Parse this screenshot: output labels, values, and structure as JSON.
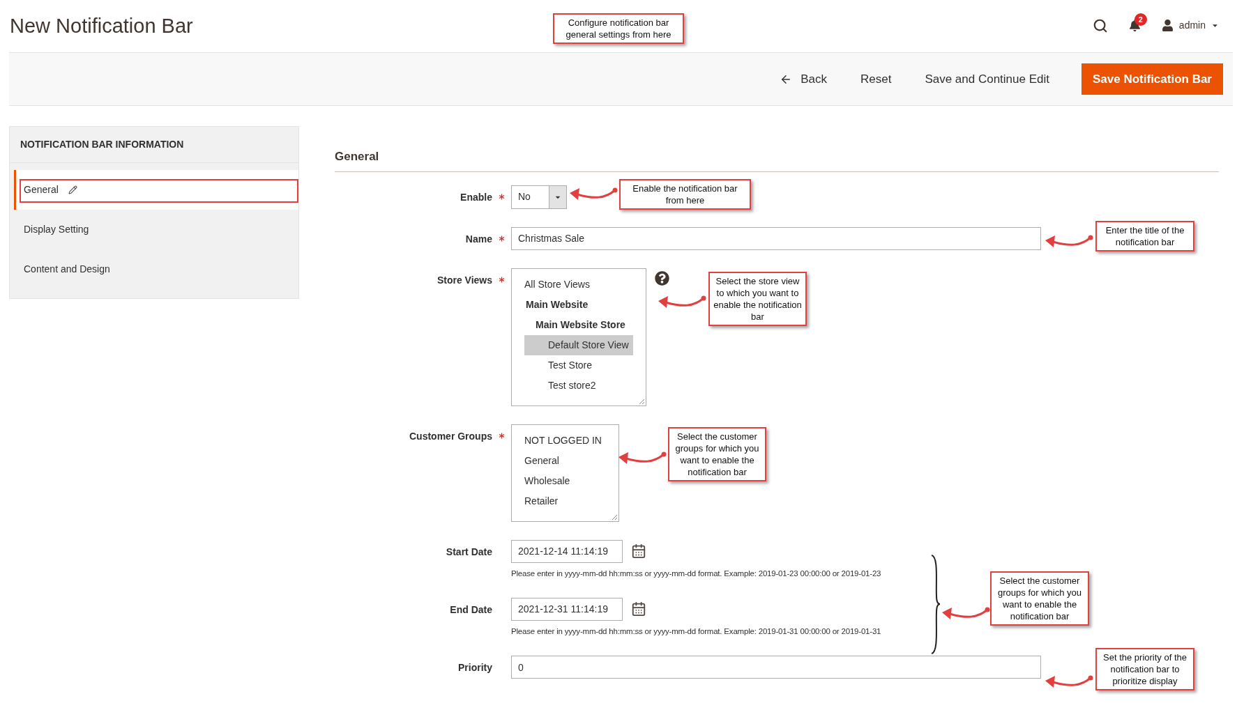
{
  "header": {
    "title": "New Notification Bar",
    "notification_count": "2",
    "user": "admin"
  },
  "actions": [
    {
      "label": "Back",
      "kind": "back"
    },
    {
      "label": "Reset",
      "kind": "plain"
    },
    {
      "label": "Save and Continue Edit",
      "kind": "plain"
    },
    {
      "label": "Save Notification Bar",
      "kind": "primary"
    }
  ],
  "sidebar": {
    "title": "NOTIFICATION BAR INFORMATION",
    "items": [
      {
        "label": "General",
        "selected": true
      },
      {
        "label": "Display Setting",
        "selected": false
      },
      {
        "label": "Content and Design",
        "selected": false
      }
    ]
  },
  "form": {
    "section_title": "General",
    "fields": [
      {
        "kind": "select",
        "label": "Enable",
        "required": true,
        "value": "No"
      },
      {
        "kind": "text",
        "label": "Name",
        "required": true,
        "value": "Christmas Sale"
      },
      {
        "kind": "multiselect",
        "label": "Store Views",
        "required": true,
        "help": true,
        "options": [
          {
            "label": "All Store Views",
            "kind": "option",
            "selected": false
          },
          {
            "label": "Main Website",
            "kind": "group",
            "selected": false
          },
          {
            "label": "Main Website Store",
            "kind": "subgroup",
            "selected": false
          },
          {
            "label": "Default Store View",
            "kind": "store",
            "selected": true
          },
          {
            "label": "Test Store",
            "kind": "store",
            "selected": false
          },
          {
            "label": "Test store2",
            "kind": "store",
            "selected": false
          }
        ]
      },
      {
        "kind": "multiselect",
        "label": "Customer Groups",
        "required": true,
        "help": false,
        "options": [
          {
            "label": "NOT LOGGED IN",
            "kind": "option",
            "selected": false
          },
          {
            "label": "General",
            "kind": "option",
            "selected": false
          },
          {
            "label": "Wholesale",
            "kind": "option",
            "selected": false
          },
          {
            "label": "Retailer",
            "kind": "option",
            "selected": false
          }
        ]
      },
      {
        "kind": "date",
        "label": "Start Date",
        "required": false,
        "value": "2021-12-14 11:14:19",
        "note": "Please enter in yyyy-mm-dd hh:mm:ss or yyyy-mm-dd format. Example: 2019-01-23 00:00:00 or 2019-01-23"
      },
      {
        "kind": "date",
        "label": "End Date",
        "required": false,
        "value": "2021-12-31 11:14:19",
        "note": "Please enter in yyyy-mm-dd hh:mm:ss or yyyy-mm-dd format. Example: 2019-01-31 00:00:00 or 2019-01-31"
      },
      {
        "kind": "text",
        "label": "Priority",
        "required": false,
        "value": "0"
      }
    ]
  },
  "annotations": [
    "Configure notification bar general settings from here",
    "Enable the notification bar from here",
    "Enter the title of the notification bar",
    "Select the store view to which you want to enable the notification bar",
    "Select the customer groups for which you want to enable the notification bar",
    "Select the customer groups for which you want to enable the notification bar",
    "Set the priority of the notification bar to prioritize display"
  ]
}
